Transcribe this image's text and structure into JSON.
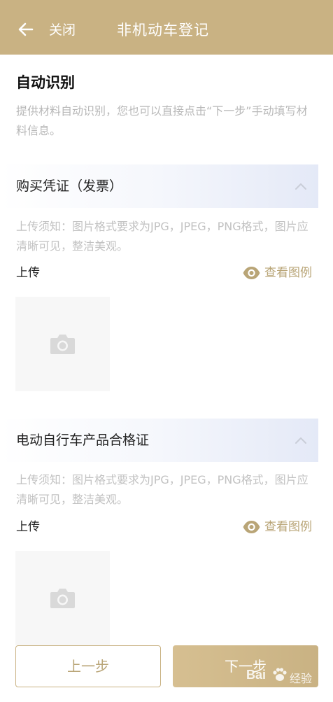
{
  "header": {
    "close_label": "关闭",
    "title": "非机动车登记",
    "background": "#c9b283"
  },
  "auto_recognition": {
    "title": "自动识别",
    "description": "提供材料自动识别，您也可以直接点击“下一步”手动填写材料信息。"
  },
  "sections": [
    {
      "title": "购买凭证（发票）",
      "notice": "上传须知：图片格式要求为JPG，JPEG，PNG格式，图片应清晰可见，整洁美观。",
      "upload_label": "上传",
      "view_example_label": "查看图例"
    },
    {
      "title": "电动自行车产品合格证",
      "notice": "上传须知：图片格式要求为JPG，JPEG，PNG格式，图片应清晰可见，整洁美观。",
      "upload_label": "上传",
      "view_example_label": "查看图例"
    }
  ],
  "footer": {
    "prev_label": "上一步",
    "next_label": "下一步"
  },
  "watermark": {
    "brand": "Bai",
    "suffix": "经验"
  },
  "icons": {
    "back": "arrow-left-icon",
    "collapse": "chevron-up-icon",
    "view": "eye-icon",
    "upload": "camera-icon"
  },
  "colors": {
    "accent": "#c9b283",
    "accent_text": "#b9a577",
    "muted_text": "#b8b8b8",
    "upload_box": "#f7f7f7"
  }
}
